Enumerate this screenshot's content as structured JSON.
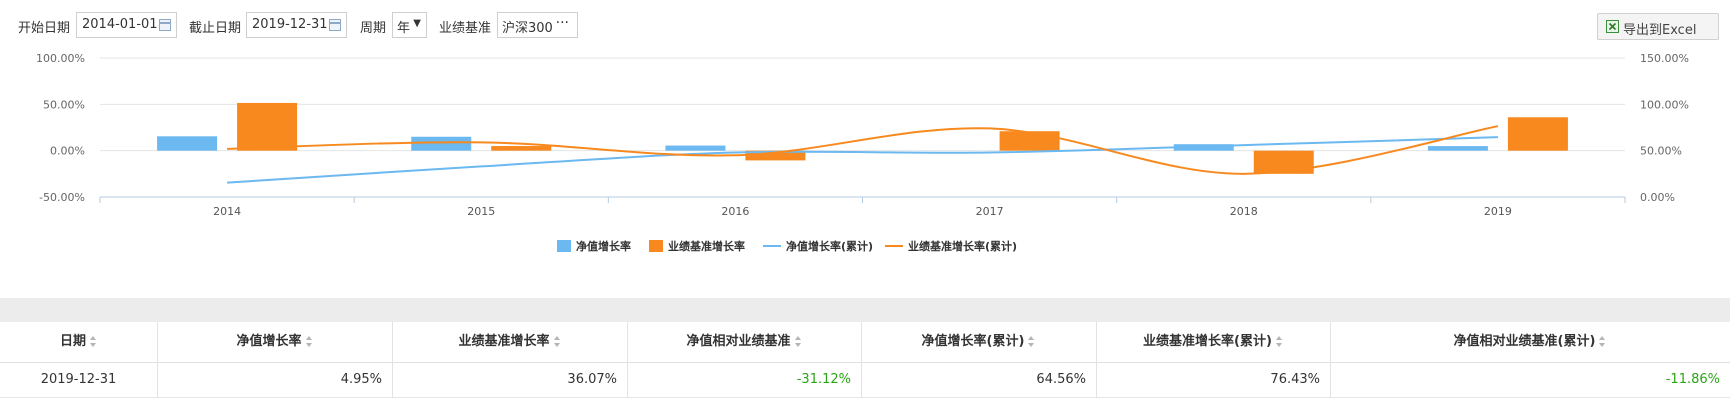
{
  "toolbar": {
    "start_label": "开始日期",
    "start_value": "2014-01-01",
    "end_label": "截止日期",
    "end_value": "2019-12-31",
    "period_label": "周期",
    "period_value": "年",
    "benchmark_label": "业绩基准",
    "benchmark_value": "沪深300",
    "benchmark_more": "···",
    "export_label": "导出到Excel"
  },
  "chart_data": {
    "type": "bar",
    "categories": [
      "2014",
      "2015",
      "2016",
      "2017",
      "2018",
      "2019"
    ],
    "left_axis": {
      "min": -50,
      "max": 100,
      "ticks": [
        "-50.00%",
        "0.00%",
        "50.00%",
        "100.00%"
      ]
    },
    "right_axis": {
      "min": 0,
      "max": 150,
      "ticks": [
        "0.00%",
        "50.00%",
        "100.00%",
        "150.00%"
      ]
    },
    "series": [
      {
        "name": "净值增长率",
        "kind": "bar",
        "axis": "left",
        "color": "#6bb9f0",
        "values": [
          15.5,
          15.0,
          5.5,
          0.0,
          7.0,
          4.95
        ]
      },
      {
        "name": "业绩基准增长率",
        "kind": "bar",
        "axis": "left",
        "color": "#f7891f",
        "values": [
          51.5,
          5.0,
          -10.5,
          21.0,
          -25.0,
          36.07
        ]
      },
      {
        "name": "净值增长率(累计)",
        "kind": "line",
        "axis": "right",
        "color": "#6bb9f0",
        "values": [
          15.5,
          33.0,
          48.0,
          48.0,
          56.0,
          64.56
        ]
      },
      {
        "name": "业绩基准增长率(累计)",
        "kind": "line",
        "axis": "right",
        "color": "#f7891f",
        "values": [
          52.0,
          59.0,
          45.0,
          74.0,
          25.0,
          76.43
        ]
      }
    ]
  },
  "table": {
    "columns": [
      "日期",
      "净值增长率",
      "业绩基准增长率",
      "净值相对业绩基准",
      "净值增长率(累计)",
      "业绩基准增长率(累计)",
      "净值相对业绩基准(累计)"
    ],
    "rows": [
      [
        "2019-12-31",
        "4.95%",
        "36.07%",
        "-31.12%",
        "64.56%",
        "76.43%",
        "-11.86%"
      ]
    ]
  }
}
